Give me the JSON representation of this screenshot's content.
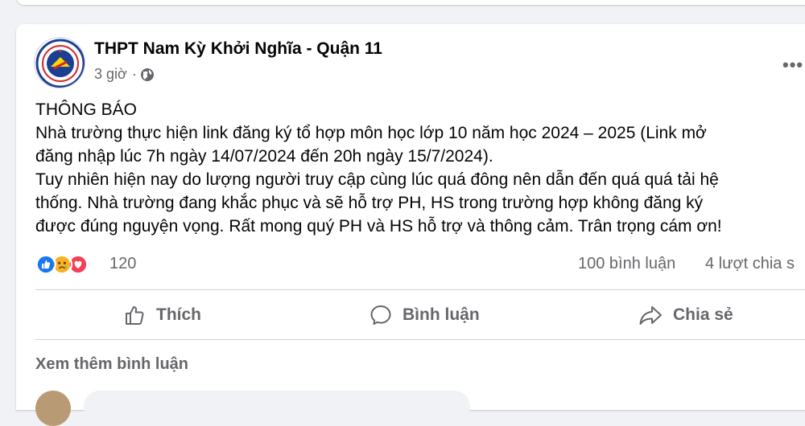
{
  "post": {
    "page_name": "THPT Nam Kỳ Khởi Nghĩa - Quận 11",
    "time": "3 giờ",
    "separator": "·",
    "privacy_icon": "globe-icon",
    "more_icon": "•••",
    "text": "THÔNG BÁO\nNhà trường thực hiện link đăng ký tổ hợp môn học lớp 10 năm học 2024 – 2025 (Link mở\nđăng nhập lúc 7h ngày 14/07/2024 đến 20h ngày 15/7/2024).\nTuy nhiên hiện nay do lượng người truy cập cùng lúc quá đông nên dẫn đến quá quá tải hệ\nthống. Nhà trường đang khắc phục và sẽ hỗ trợ PH, HS trong trường hợp không đăng ký\nđược đúng nguyện vọng. Rất mong quý PH và HS hỗ trợ và thông cảm. Trân trọng cám ơn!"
  },
  "stats": {
    "reaction_icons": [
      "like-icon",
      "sad-icon",
      "love-icon"
    ],
    "reaction_count": "120",
    "comments": "100 bình luận",
    "shares": "4 lượt chia s"
  },
  "actions": {
    "like": "Thích",
    "comment": "Bình luận",
    "share": "Chia sẻ"
  },
  "comments_section": {
    "view_more": "Xem thêm bình luận"
  },
  "colors": {
    "like_blue": "#1877f2",
    "love_red": "#f33e58",
    "sad_yellow": "#f7b125",
    "secondary_text": "#65676b"
  }
}
